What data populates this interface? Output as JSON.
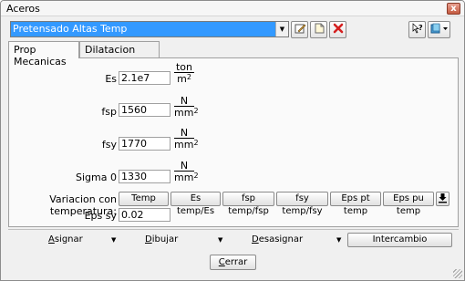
{
  "window": {
    "title": "Aceros",
    "close_glyph": "x"
  },
  "material_selector": {
    "value": "Pretensado Altas Temp",
    "arrow_icon": "chevron-down-icon"
  },
  "toolbar": {
    "edit_icon": "edit-icon",
    "new_icon": "new-document-icon",
    "delete_icon": "delete-icon",
    "help_icon": "help-icon",
    "extra_icon": "book-icon"
  },
  "tabs": [
    {
      "label": "Prop Mecanicas",
      "active": true
    },
    {
      "label": "Dilatacion termica",
      "active": false
    }
  ],
  "properties": [
    {
      "label": "Es",
      "value": "2.1e7",
      "unit_num": "ton",
      "unit_den": "m",
      "unit_exp": "2"
    },
    {
      "label": "fsp",
      "value": "1560",
      "unit_num": "N",
      "unit_den": "mm",
      "unit_exp": "2"
    },
    {
      "label": "fsy",
      "value": "1770",
      "unit_num": "N",
      "unit_den": "mm",
      "unit_exp": "2"
    },
    {
      "label": "Sigma 0",
      "value": "1330",
      "unit_num": "N",
      "unit_den": "mm",
      "unit_exp": "2"
    }
  ],
  "temperature": {
    "label": "Variacion con temperatura:",
    "buttons": [
      "Temp",
      "Es temp/Es",
      "fsp temp/fsp",
      "fsy temp/fsy",
      "Eps pt temp",
      "Eps pu temp"
    ],
    "download_icon": "download-icon"
  },
  "eps_sy": {
    "label": "Eps sy",
    "value": "0.02"
  },
  "bottom_bar": {
    "assign": "Asignar",
    "assign_key": "A",
    "draw": "Dibujar",
    "draw_key": "D",
    "unassign": "Desasignar",
    "unassign_key": "D",
    "swap": "Intercambio"
  },
  "close_button": "Cerrar",
  "close_key": "C"
}
